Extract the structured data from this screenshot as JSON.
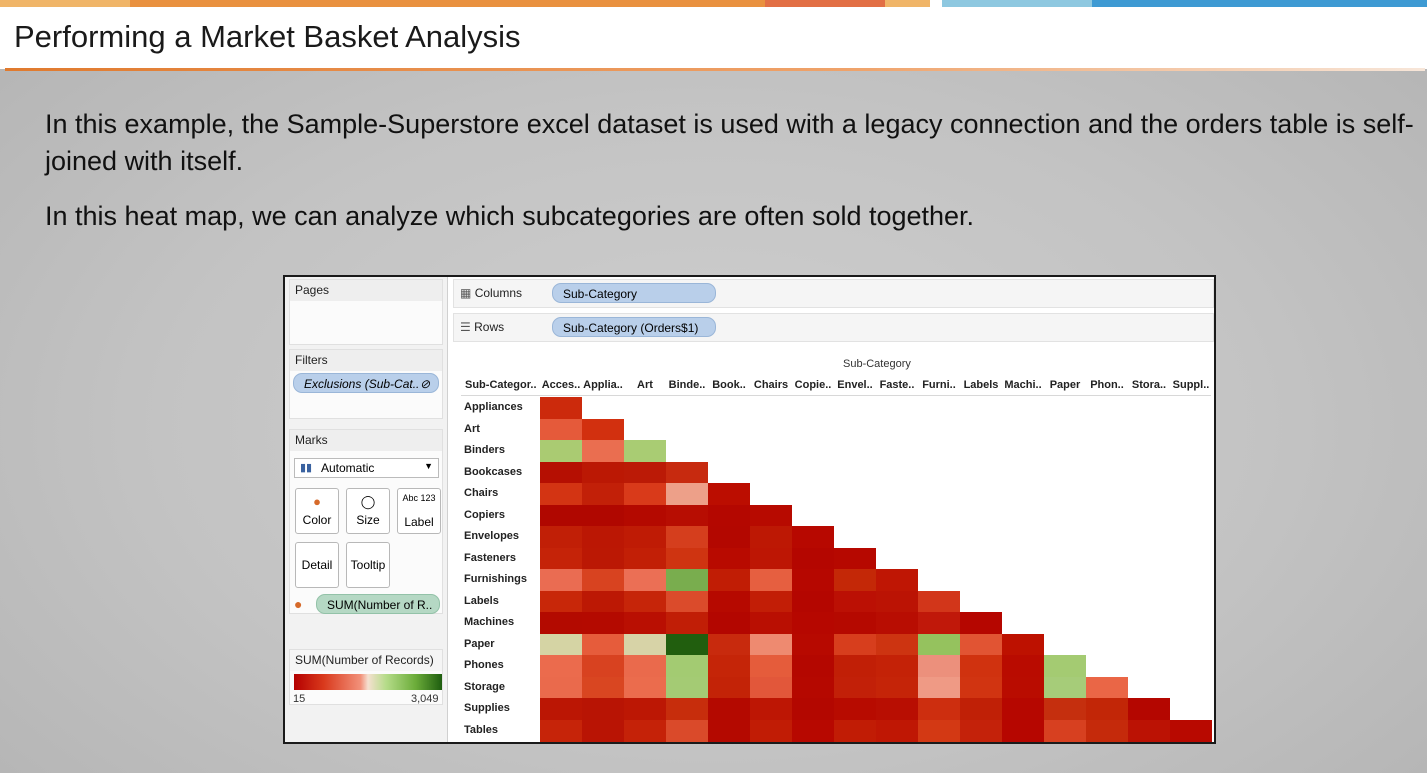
{
  "slide": {
    "title": "Performing a Market Basket Analysis",
    "paragraph1": "In this example, the Sample-Superstore excel dataset is used with a legacy connection and the orders table is self-joined with itself.",
    "paragraph2": "In this heat map, we can analyze which subcategories are often sold together."
  },
  "tableau": {
    "pages_label": "Pages",
    "filters_label": "Filters",
    "filter_pill": "Exclusions (Sub-Cat..",
    "marks_label": "Marks",
    "mark_type": "Automatic",
    "buttons": {
      "color": "Color",
      "size": "Size",
      "label": "Label",
      "detail": "Detail",
      "tooltip": "Tooltip",
      "label_icon": "Abc 123"
    },
    "measure_pill": "SUM(Number of R..",
    "legend": {
      "title": "SUM(Number of Records)",
      "min": "15",
      "max": "3,049",
      "colors": [
        "#b40000",
        "#f5e0d0",
        "#1e5d0f"
      ]
    },
    "columns_label": "Columns",
    "columns_pill": "Sub-Category",
    "rows_label": "Rows",
    "rows_pill": "Sub-Category (Orders$1)",
    "column_header": "Sub-Category",
    "row_header": "Sub-Categor..",
    "col_labels": [
      "Acces..",
      "Applia..",
      "Art",
      "Binde..",
      "Book..",
      "Chairs",
      "Copie..",
      "Envel..",
      "Faste..",
      "Furni..",
      "Labels",
      "Machi..",
      "Paper",
      "Phon..",
      "Stora..",
      "Suppl.."
    ],
    "row_labels": [
      "Appliances",
      "Art",
      "Binders",
      "Bookcases",
      "Chairs",
      "Copiers",
      "Envelopes",
      "Fasteners",
      "Furnishings",
      "Labels",
      "Machines",
      "Paper",
      "Phones",
      "Storage",
      "Supplies",
      "Tables"
    ],
    "heatmap": [
      [
        "#cc2a0c"
      ],
      [
        "#e55a3a",
        "#d2300f"
      ],
      [
        "#aacb72",
        "#ea6e50",
        "#a9cc73"
      ],
      [
        "#b50f02",
        "#bb1804",
        "#bb1a06",
        "#c72a0f"
      ],
      [
        "#d33413",
        "#c22008",
        "#d93a1a",
        "#eda089",
        "#bb0d00"
      ],
      [
        "#b00700",
        "#b00700",
        "#b40900",
        "#b70d02",
        "#b40700",
        "#b70a00"
      ],
      [
        "#c11f06",
        "#bb1704",
        "#bf1b05",
        "#d53e1d",
        "#b30700",
        "#bd1804",
        "#b70800"
      ],
      [
        "#c52308",
        "#bb1804",
        "#c21f06",
        "#cf3411",
        "#b80a00",
        "#bd1604",
        "#b40600",
        "#b60800"
      ],
      [
        "#ea6c52",
        "#d84320",
        "#eb6f55",
        "#79ad4e",
        "#c11d05",
        "#e65f40",
        "#b60700",
        "#c42807",
        "#bf1604"
      ],
      [
        "#c82709",
        "#bc1804",
        "#c62509",
        "#db4b2b",
        "#b60900",
        "#c21e06",
        "#b40600",
        "#bb1004",
        "#bb1304",
        "#d2361a"
      ],
      [
        "#b30a00",
        "#b40a00",
        "#b90f02",
        "#c11e06",
        "#b30600",
        "#b90f02",
        "#b60700",
        "#b50900",
        "#b80d02",
        "#c0180a",
        "#b50600"
      ],
      [
        "#d5d4a4",
        "#e65c3b",
        "#d7d3a7",
        "#215e0e",
        "#c82a0d",
        "#ee8a70",
        "#b70900",
        "#d73e1d",
        "#cd3411",
        "#95c25e",
        "#e15433",
        "#bd1100"
      ],
      [
        "#eb6b4d",
        "#d84220",
        "#ea6a4c",
        "#a3cb72",
        "#c52508",
        "#e55c3b",
        "#b40700",
        "#c11f06",
        "#c42207",
        "#ec907c",
        "#d0320f",
        "#b90b00",
        "#a4cb72"
      ],
      [
        "#ea6a4c",
        "#d94621",
        "#eb6c4d",
        "#a4cb74",
        "#c32307",
        "#e2573a",
        "#b50800",
        "#c22008",
        "#c52408",
        "#ef9a85",
        "#d13411",
        "#b90c00",
        "#a6cc79",
        "#ea6646"
      ],
      [
        "#bb1604",
        "#b81404",
        "#bc1704",
        "#c72d0c",
        "#b40900",
        "#bd1604",
        "#b30700",
        "#b70b00",
        "#b80e02",
        "#cd2e0f",
        "#c02006",
        "#b60700",
        "#c52f0e",
        "#c22607",
        "#b40600"
      ],
      [
        "#c62409",
        "#b91404",
        "#c52208",
        "#da4a2a",
        "#b40900",
        "#c11c05",
        "#b70800",
        "#c11c05",
        "#bf1704",
        "#d33914",
        "#c4220a",
        "#b60600",
        "#d74020",
        "#c52a0b",
        "#bb1204",
        "#b80900"
      ]
    ]
  }
}
